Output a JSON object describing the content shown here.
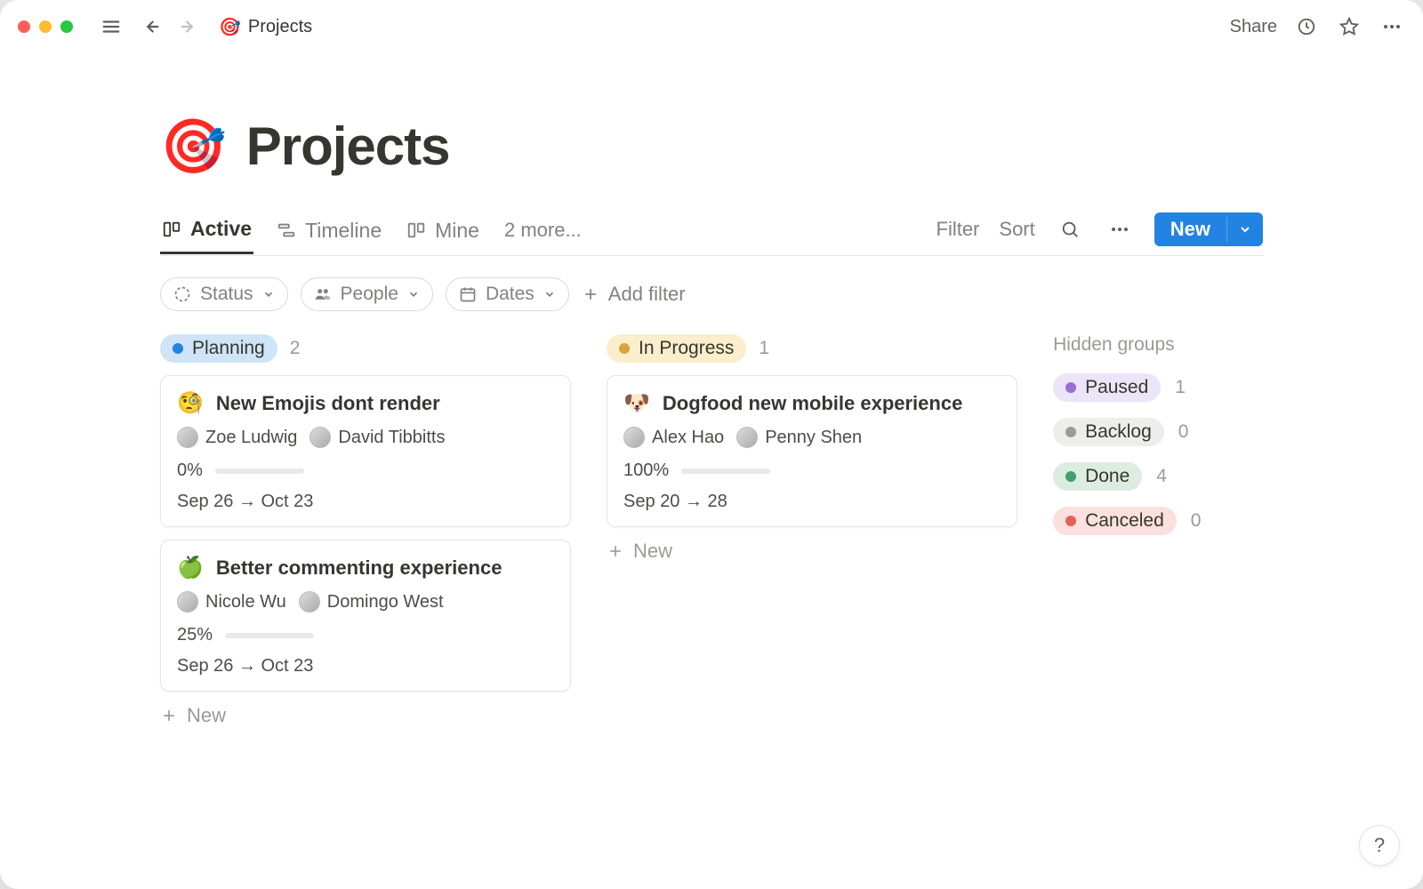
{
  "topbar": {
    "breadcrumb_emoji": "🎯",
    "breadcrumb_title": "Projects",
    "share_label": "Share"
  },
  "page": {
    "emoji": "🎯",
    "title": "Projects"
  },
  "views": {
    "tabs": [
      {
        "label": "Active",
        "icon": "board",
        "active": true
      },
      {
        "label": "Timeline",
        "icon": "timeline",
        "active": false
      },
      {
        "label": "Mine",
        "icon": "board",
        "active": false
      }
    ],
    "more_label": "2 more..."
  },
  "actions": {
    "filter_label": "Filter",
    "sort_label": "Sort",
    "new_label": "New"
  },
  "filters": {
    "chips": [
      {
        "icon": "status",
        "label": "Status"
      },
      {
        "icon": "people",
        "label": "People"
      },
      {
        "icon": "dates",
        "label": "Dates"
      }
    ],
    "add_label": "Add filter"
  },
  "board": {
    "new_label": "New",
    "columns": [
      {
        "status_key": "planning",
        "status_label": "Planning",
        "count": "2",
        "cards": [
          {
            "emoji": "🧐",
            "title": "New Emojis dont  render",
            "people": [
              {
                "name": "Zoe Ludwig"
              },
              {
                "name": "David Tibbitts"
              }
            ],
            "progress_label": "0%",
            "progress_pct": 0,
            "dates": "Sep 26 → Oct 23"
          },
          {
            "emoji": "🍏",
            "title": "Better commenting experience",
            "people": [
              {
                "name": "Nicole Wu"
              },
              {
                "name": "Domingo West"
              }
            ],
            "progress_label": "25%",
            "progress_pct": 25,
            "dates": "Sep 26 → Oct 23"
          }
        ]
      },
      {
        "status_key": "progress",
        "status_label": "In Progress",
        "count": "1",
        "cards": [
          {
            "emoji": "🐶",
            "title": "Dogfood new mobile experience",
            "people": [
              {
                "name": "Alex Hao"
              },
              {
                "name": "Penny Shen"
              }
            ],
            "progress_label": "100%",
            "progress_pct": 100,
            "dates": "Sep 20 → 28"
          }
        ]
      }
    ]
  },
  "hidden": {
    "heading": "Hidden groups",
    "groups": [
      {
        "key": "paused",
        "label": "Paused",
        "count": "1"
      },
      {
        "key": "backlog",
        "label": "Backlog",
        "count": "0"
      },
      {
        "key": "done",
        "label": "Done",
        "count": "4"
      },
      {
        "key": "canceled",
        "label": "Canceled",
        "count": "0"
      }
    ]
  },
  "help_label": "?"
}
